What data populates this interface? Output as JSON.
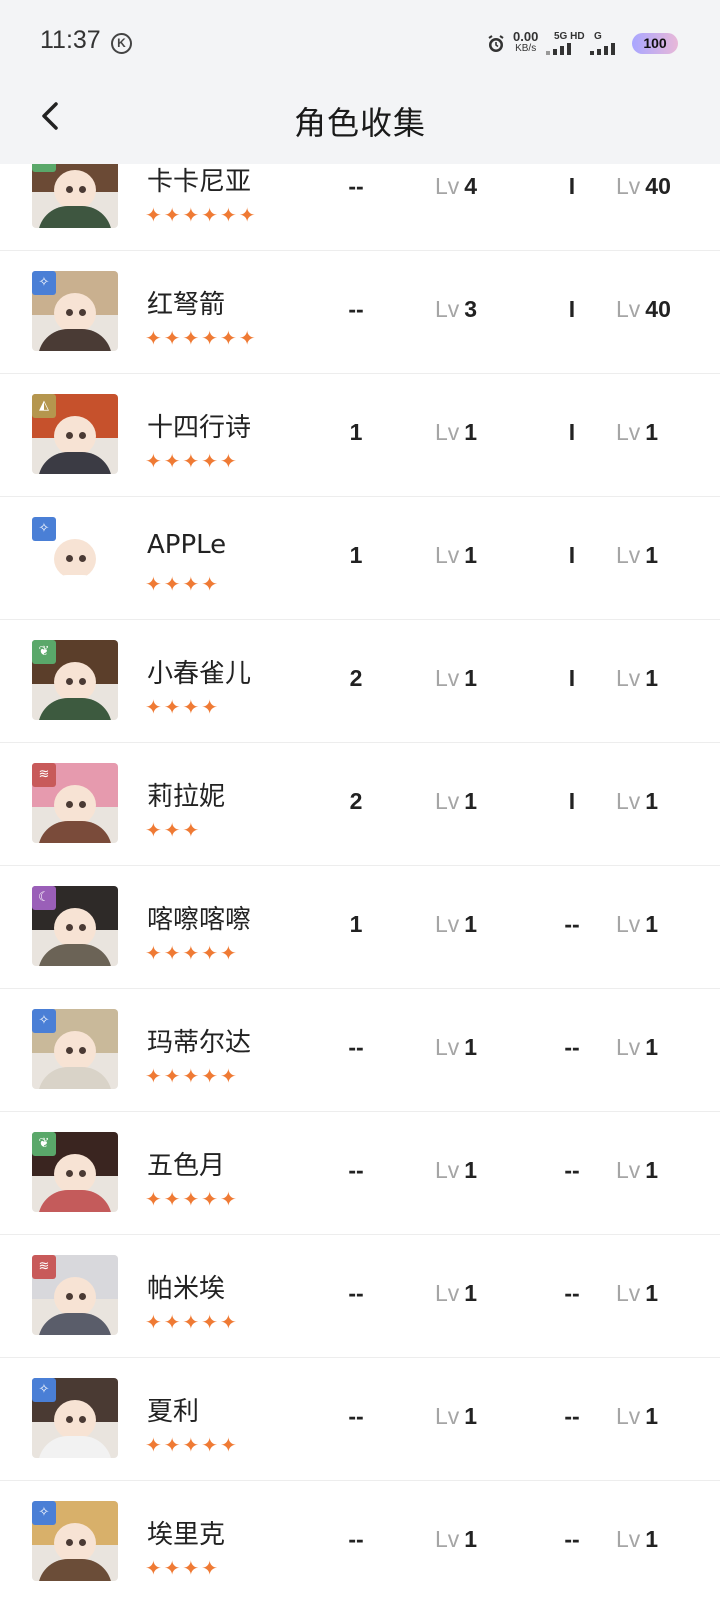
{
  "status": {
    "time": "11:37",
    "k_badge": "K",
    "speed_value": "0.00",
    "speed_unit": "KB/s",
    "net1": "5G HD",
    "net2": "G",
    "battery": "100"
  },
  "nav": {
    "title": "角色收集",
    "back_icon": "chevron-left-icon"
  },
  "colors": {
    "star": "#ef7a34",
    "elem_blue": "#4a7fd6",
    "elem_green": "#5aa86a",
    "elem_gold": "#b5964e",
    "elem_red": "#c85a5a",
    "elem_purple": "#9a5fb8"
  },
  "rows": [
    {
      "name": "卡卡尼亚",
      "stars": "✦✦✦✦✦✦",
      "elem": "leaf-icon",
      "col1": "--",
      "lv1_prefix": "Lv",
      "lv1": "4",
      "col3": "I",
      "lv2_prefix": "Lv",
      "lv2": "40"
    },
    {
      "name": "红弩箭",
      "stars": "✦✦✦✦✦✦",
      "elem": "star-icon",
      "col1": "--",
      "lv1_prefix": "Lv",
      "lv1": "3",
      "col3": "I",
      "lv2_prefix": "Lv",
      "lv2": "40"
    },
    {
      "name": "十四行诗",
      "stars": "✦✦✦✦✦",
      "elem": "rock-icon",
      "col1": "1",
      "lv1_prefix": "Lv",
      "lv1": "1",
      "col3": "I",
      "lv2_prefix": "Lv",
      "lv2": "1"
    },
    {
      "name": "APPLe",
      "stars": "✦✦✦✦",
      "elem": "star-icon",
      "col1": "1",
      "lv1_prefix": "Lv",
      "lv1": "1",
      "col3": "I",
      "lv2_prefix": "Lv",
      "lv2": "1"
    },
    {
      "name": "小春雀儿",
      "stars": "✦✦✦✦",
      "elem": "leaf-icon",
      "col1": "2",
      "lv1_prefix": "Lv",
      "lv1": "1",
      "col3": "I",
      "lv2_prefix": "Lv",
      "lv2": "1"
    },
    {
      "name": "莉拉妮",
      "stars": "✦✦✦",
      "elem": "beast-icon",
      "col1": "2",
      "lv1_prefix": "Lv",
      "lv1": "1",
      "col3": "I",
      "lv2_prefix": "Lv",
      "lv2": "1"
    },
    {
      "name": "喀嚓喀嚓",
      "stars": "✦✦✦✦✦",
      "elem": "moon-icon",
      "col1": "1",
      "lv1_prefix": "Lv",
      "lv1": "1",
      "col3": "--",
      "lv2_prefix": "Lv",
      "lv2": "1"
    },
    {
      "name": "玛蒂尔达",
      "stars": "✦✦✦✦✦",
      "elem": "star-icon",
      "col1": "--",
      "lv1_prefix": "Lv",
      "lv1": "1",
      "col3": "--",
      "lv2_prefix": "Lv",
      "lv2": "1"
    },
    {
      "name": "五色月",
      "stars": "✦✦✦✦✦",
      "elem": "leaf-icon",
      "col1": "--",
      "lv1_prefix": "Lv",
      "lv1": "1",
      "col3": "--",
      "lv2_prefix": "Lv",
      "lv2": "1"
    },
    {
      "name": "帕米埃",
      "stars": "✦✦✦✦✦",
      "elem": "beast-icon",
      "col1": "--",
      "lv1_prefix": "Lv",
      "lv1": "1",
      "col3": "--",
      "lv2_prefix": "Lv",
      "lv2": "1"
    },
    {
      "name": "夏利",
      "stars": "✦✦✦✦✦",
      "elem": "star-icon",
      "col1": "--",
      "lv1_prefix": "Lv",
      "lv1": "1",
      "col3": "--",
      "lv2_prefix": "Lv",
      "lv2": "1"
    },
    {
      "name": "埃里克",
      "stars": "✦✦✦✦",
      "elem": "star-icon",
      "col1": "--",
      "lv1_prefix": "Lv",
      "lv1": "1",
      "col3": "--",
      "lv2_prefix": "Lv",
      "lv2": "1"
    }
  ]
}
